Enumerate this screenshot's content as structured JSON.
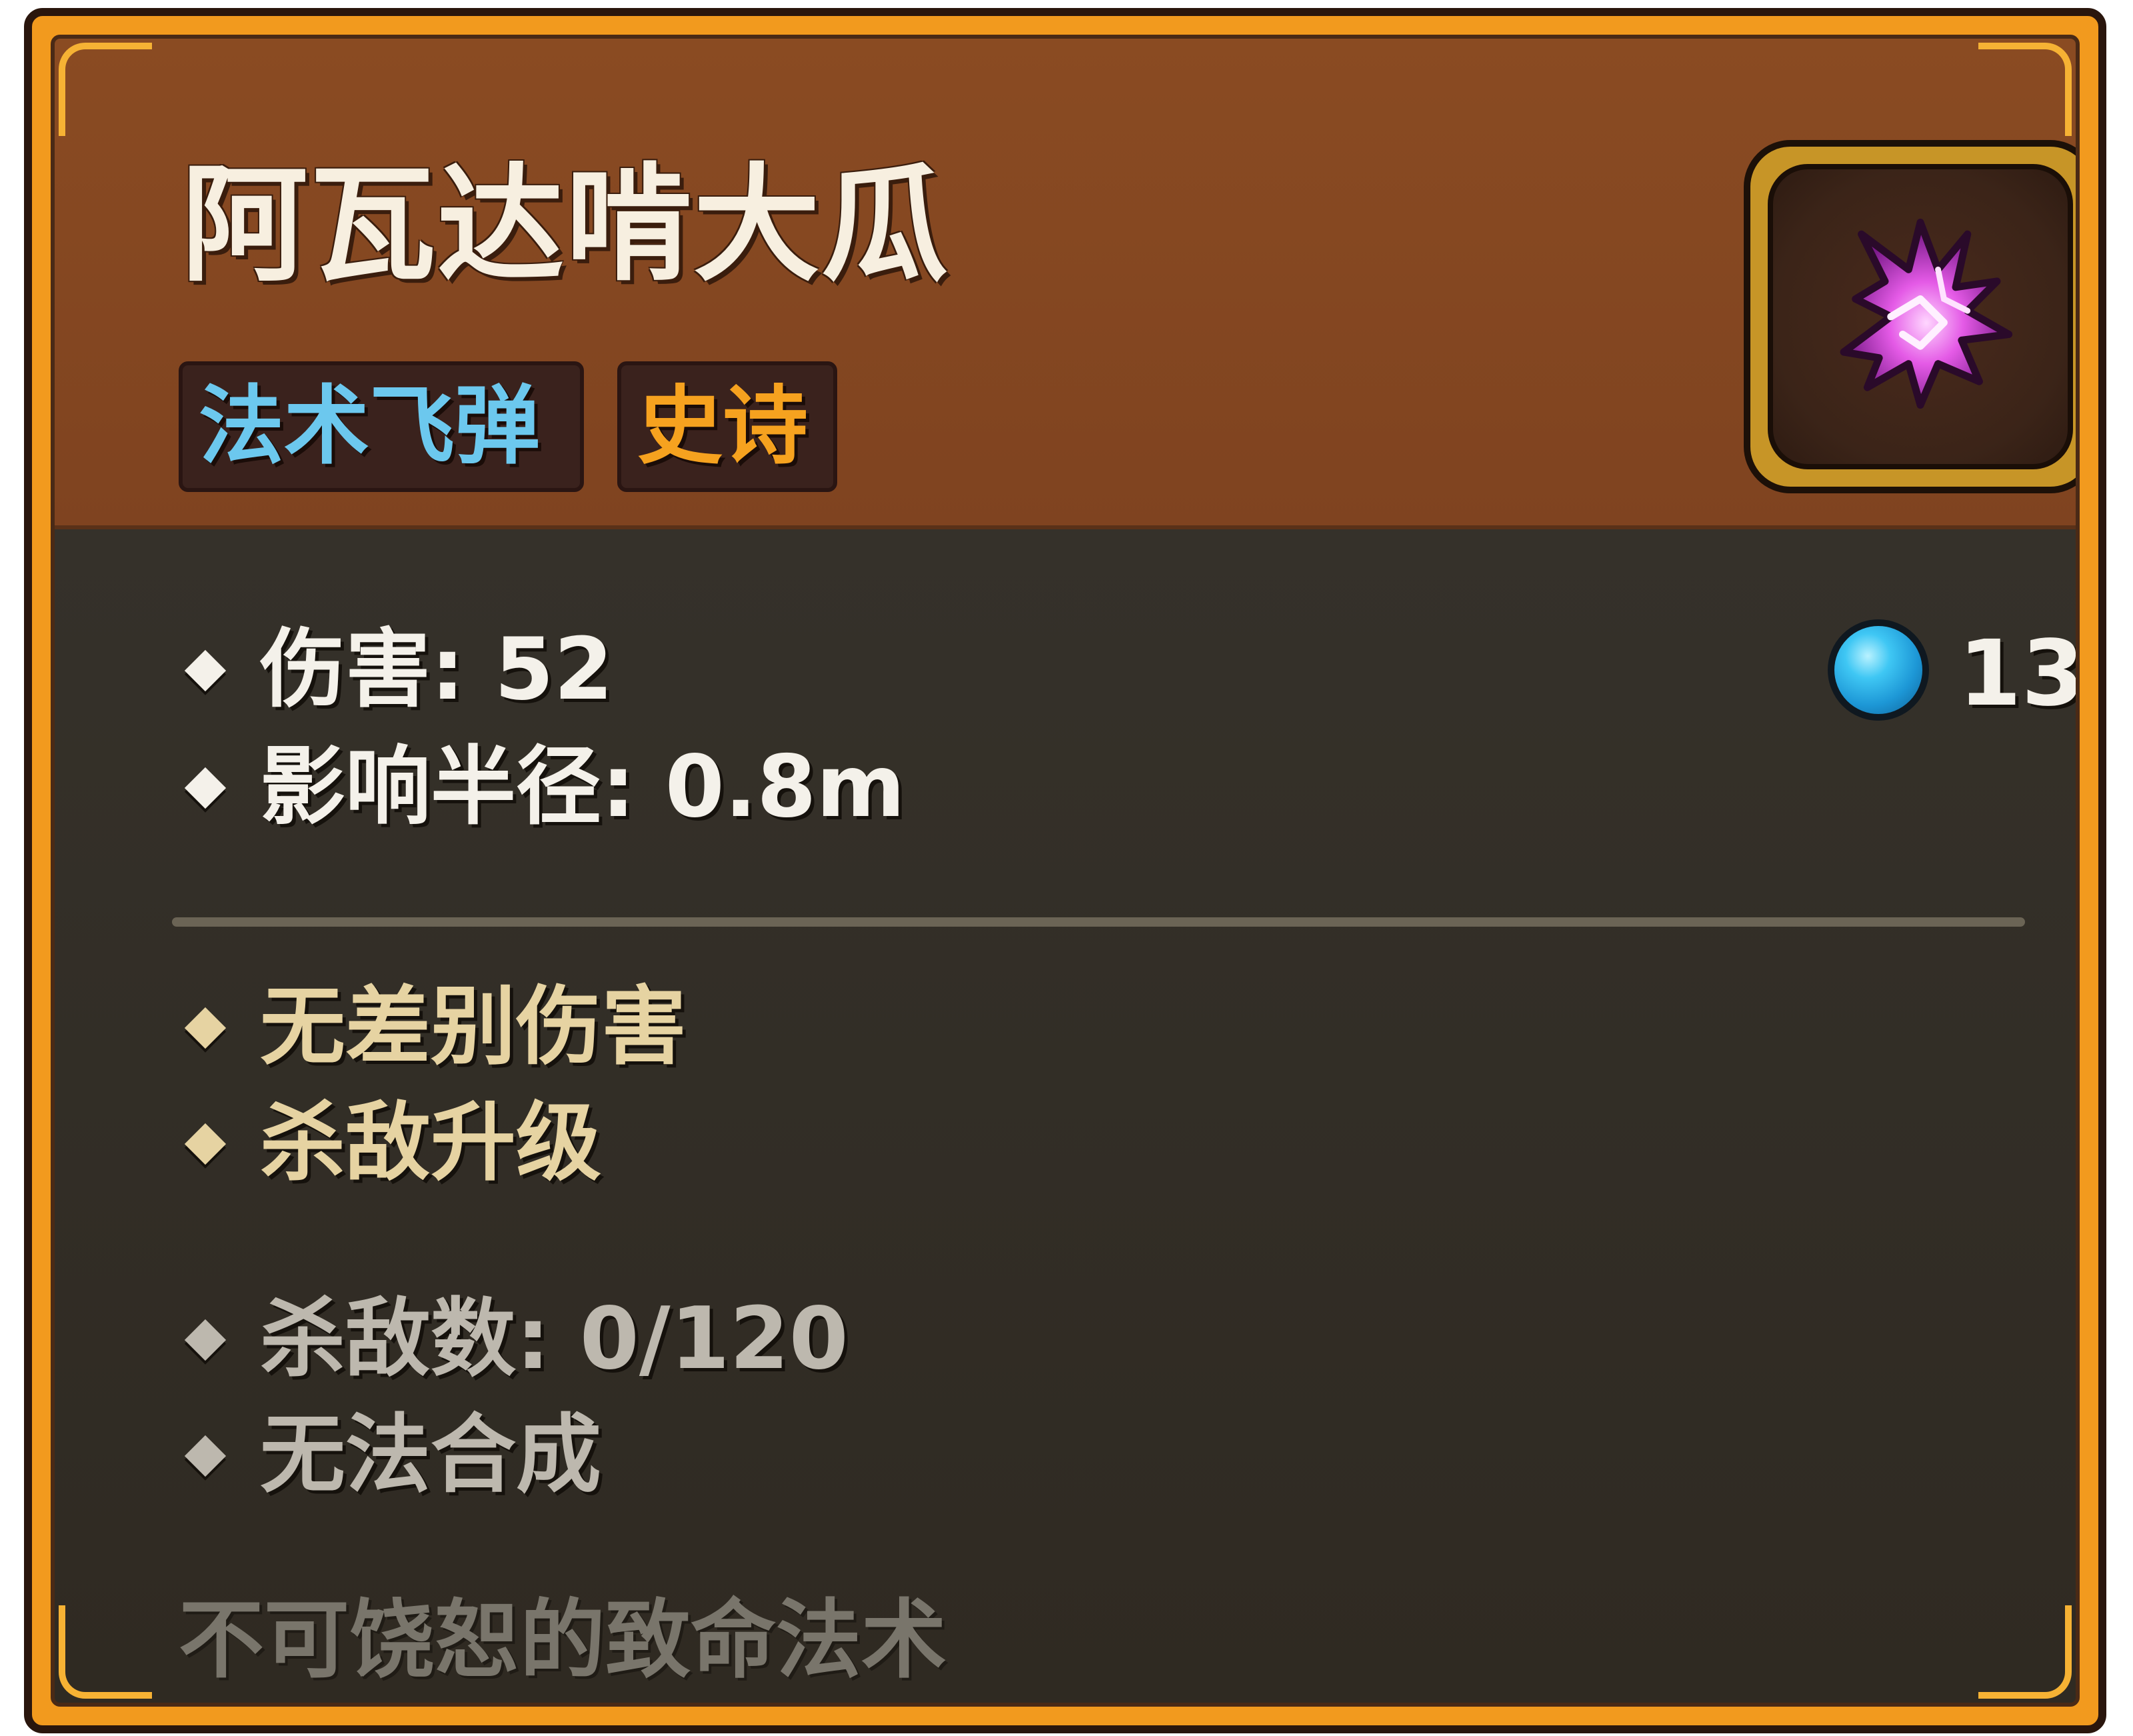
{
  "item": {
    "name": "阿瓦达啃大瓜",
    "type_tag": "法术飞弹",
    "rarity_tag": "史诗",
    "icon": "magenta-lightning-icon"
  },
  "stats": {
    "damage": "伤害: 52",
    "radius": "影响半径: 0.8m",
    "mana_cost": "13"
  },
  "traits": [
    "无差别伤害",
    "杀敌升级"
  ],
  "status": {
    "kills": "杀敌数: 0/120",
    "craft": "无法合成"
  },
  "flavor_text": "不可饶恕的致命法术",
  "colors": {
    "header": "#8a4b22",
    "body": "#302b23",
    "frame": "#f29a1e",
    "type_tag": "#6cc8ee",
    "rarity_tag": "#f6a21f",
    "trait_text": "#e6d3a2",
    "status_text": "#bdb8ae",
    "flavor_text": "#79756b",
    "mana_orb": "#3fc7f4"
  }
}
